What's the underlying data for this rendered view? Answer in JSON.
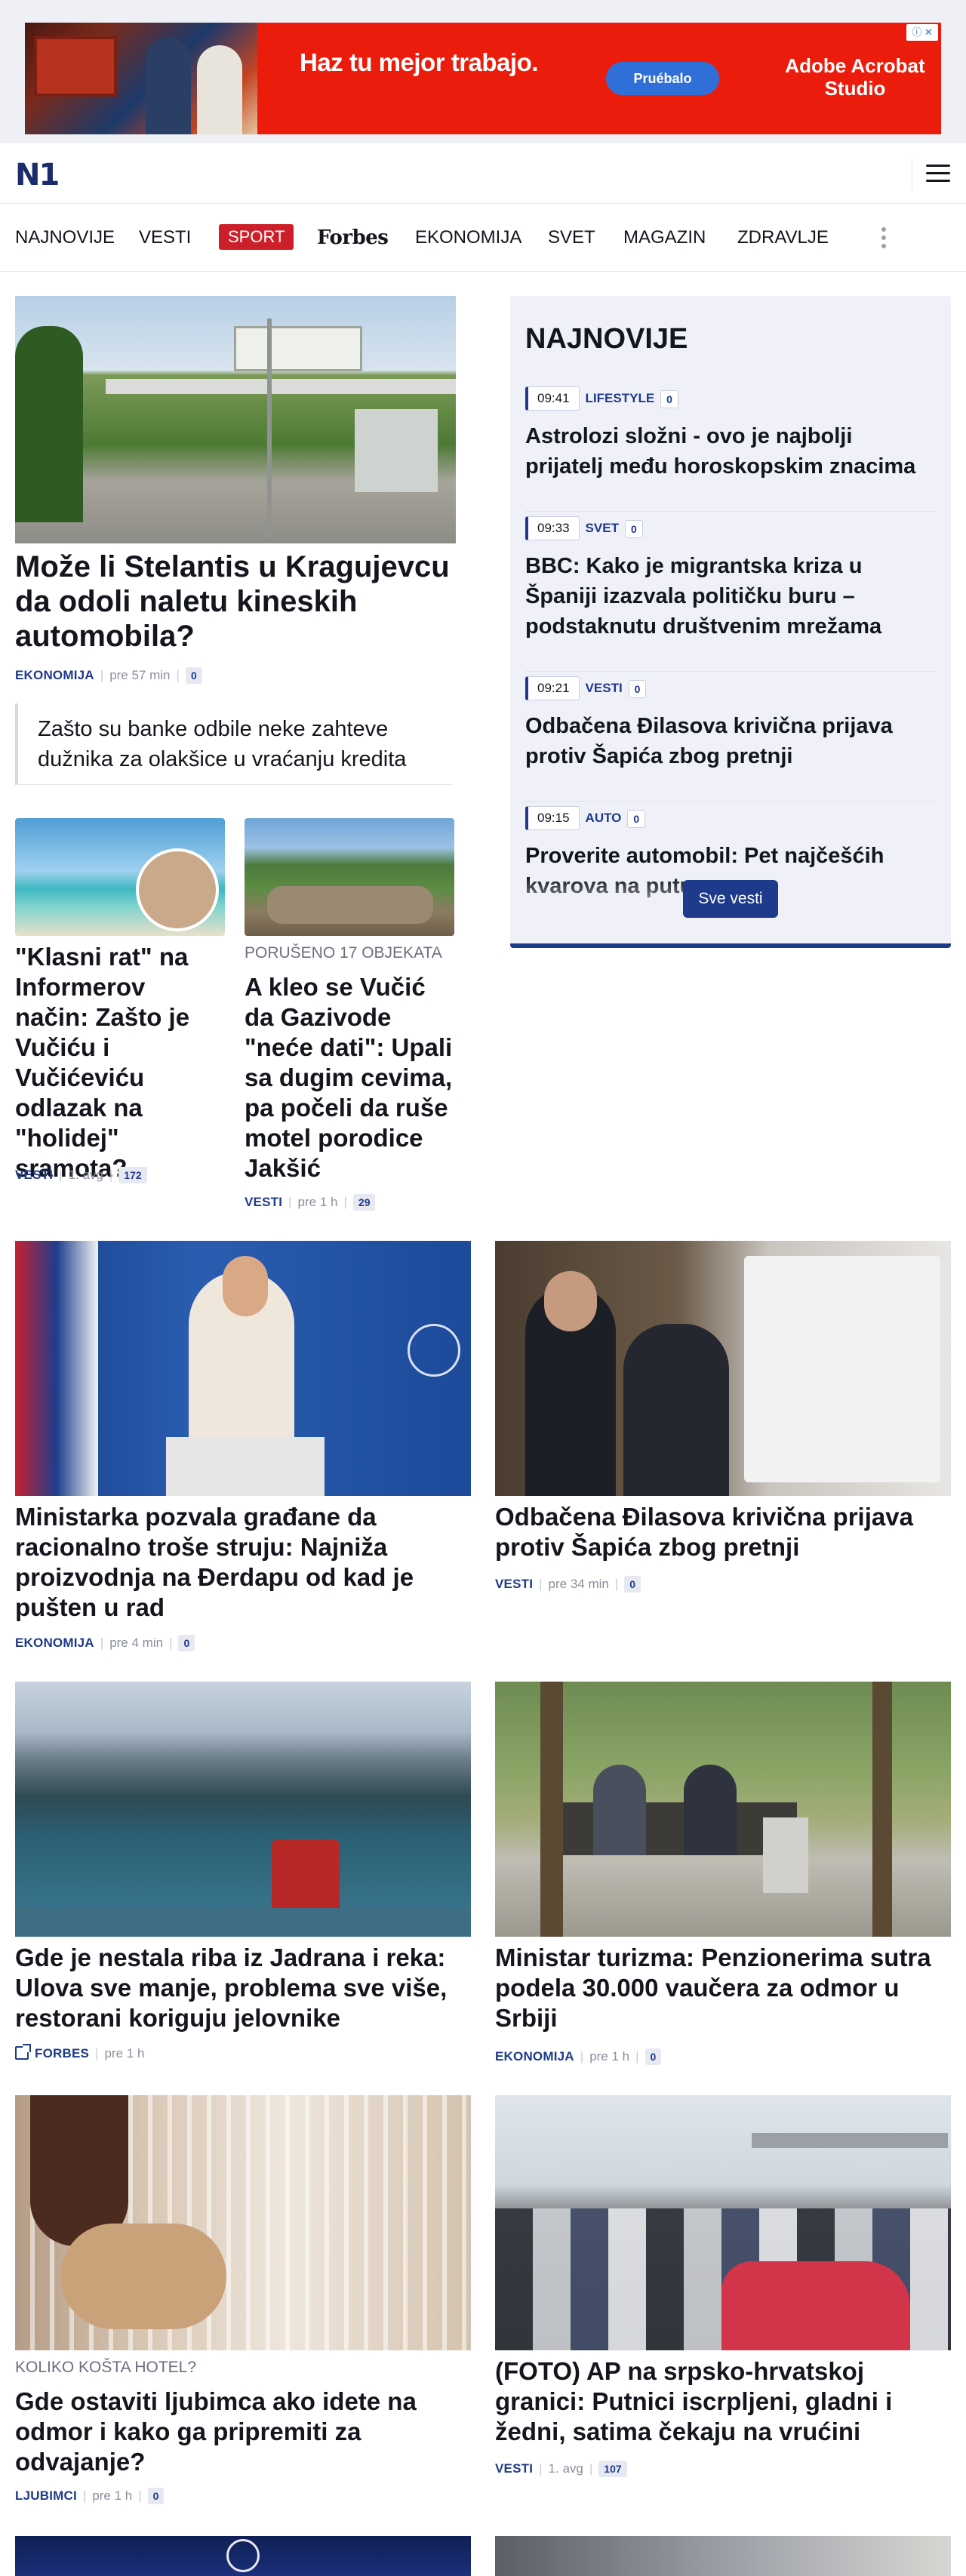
{
  "ad": {
    "headline": "Haz tu mejor trabajo.",
    "cta": "Pruébalo",
    "brand": "Adobe Acrobat Studio",
    "info_icon": "info-icon"
  },
  "header": {
    "logo": "N1"
  },
  "nav": {
    "items": [
      "NAJNOVIJE",
      "VESTI",
      "SPORT",
      "Forbes",
      "EKONOMIJA",
      "SVET",
      "MAGAZIN",
      "ZDRAVLJE"
    ]
  },
  "lead": {
    "title": "Može li Stelantis u Kragujevcu da odoli naletu kineskih automobila?",
    "category": "EKONOMIJA",
    "time": "pre 57 min",
    "comments": "0",
    "related": "Zašto su banke odbile neke zahteve dužnika za olakšice u vraćanju kredita"
  },
  "small_stories": [
    {
      "kicker": "",
      "title": "\"Klasni rat\" na Informerov način: Zašto je Vučiću i Vučićeviću odlazak na \"holidej\" sramota?",
      "category": "VESTI",
      "time": "1. avg",
      "comments": "172"
    },
    {
      "kicker": "PORUŠENO 17 OBJEKATA",
      "title": "A kleo se Vučić da Gazivode \"neće dati\": Upali sa dugim cevima, pa počeli da ruše motel porodice Jakšić",
      "category": "VESTI",
      "time": "pre 1 h",
      "comments": "29"
    }
  ],
  "najnovije": {
    "title": "NAJNOVIJE",
    "items": [
      {
        "time": "09:41",
        "category": "LIFESTYLE",
        "comments": "0",
        "title": "Astrolozi složni - ovo je najbolji prijatelj među horoskopskim znacima"
      },
      {
        "time": "09:33",
        "category": "SVET",
        "comments": "0",
        "title": "BBC: Kako je migrantska kriza u Španiji izazvala političku buru – podstaknutu društvenim mrežama"
      },
      {
        "time": "09:21",
        "category": "VESTI",
        "comments": "0",
        "title": "Odbačena Đilasova krivična prijava protiv Šapića zbog pretnji"
      },
      {
        "time": "09:15",
        "category": "AUTO",
        "comments": "0",
        "title": "Proverite automobil: Pet najčešćih kvarova na putu"
      }
    ],
    "button": "Sve vesti"
  },
  "grid": [
    {
      "kicker": "",
      "title": "Ministarka pozvala građane da racionalno troše struju: Najniža proizvodnja na Đerdapu od kad je pušten u rad",
      "category": "EKONOMIJA",
      "time": "pre 4 min",
      "comments": "0"
    },
    {
      "kicker": "",
      "title": "Odbačena Đilasova krivična prijava protiv Šapića zbog pretnji",
      "category": "VESTI",
      "time": "pre 34 min",
      "comments": "0"
    },
    {
      "kicker": "",
      "title": "Gde je nestala riba iz Jadrana i reka: Ulova sve manje, problema sve više, restorani koriguju jelovnike",
      "category": "FORBES",
      "time": "pre 1 h",
      "comments": ""
    },
    {
      "kicker": "",
      "title": "Ministar turizma: Penzionerima sutra podela 30.000 vaučera za odmor u Srbiji",
      "category": "EKONOMIJA",
      "time": "pre 1 h",
      "comments": "0"
    },
    {
      "kicker": "KOLIKO KOŠTA HOTEL?",
      "title": "Gde ostaviti ljubimca ako idete na odmor i kako ga pripremiti za odvajanje?",
      "category": "LJUBIMCI",
      "time": "pre 1 h",
      "comments": "0"
    },
    {
      "kicker": "",
      "title": "(FOTO) AP na srpsko-hrvatskoj granici: Putnici iscrpljeni, gladni i žedni, satima čekaju na vrućini",
      "category": "VESTI",
      "time": "1. avg",
      "comments": "107"
    }
  ]
}
